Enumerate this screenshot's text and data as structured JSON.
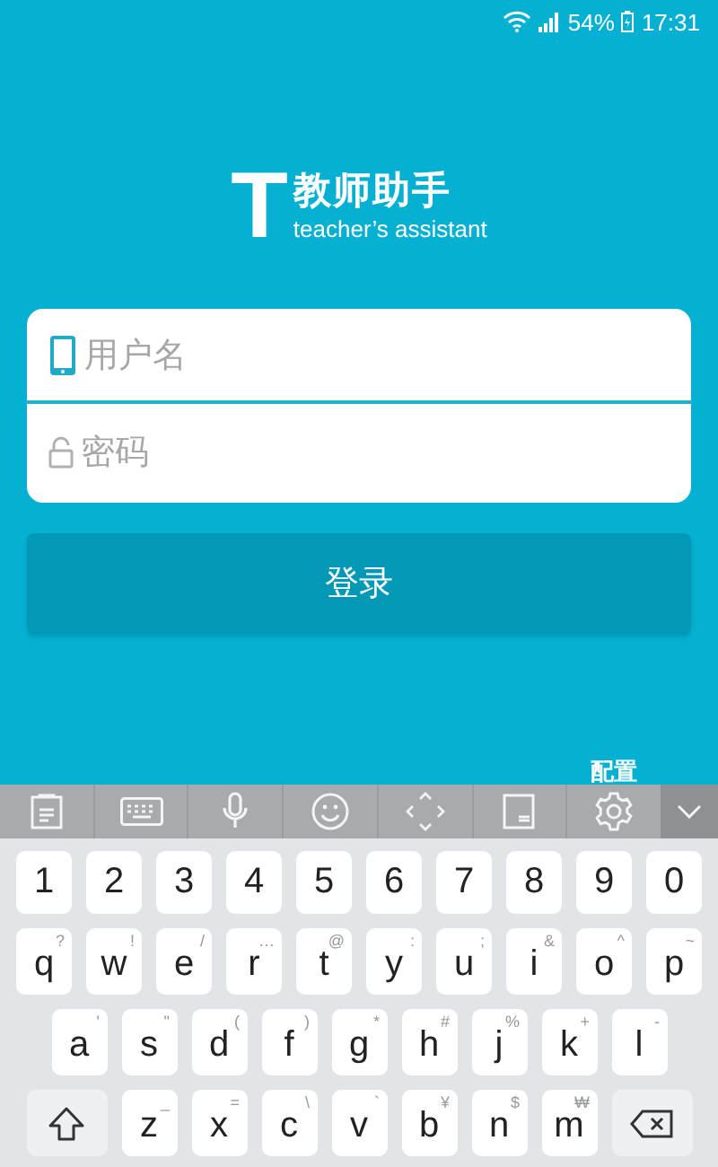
{
  "status_bar": {
    "battery": "54%",
    "time": "17:31"
  },
  "logo": {
    "letter": "T",
    "title": "教师助手",
    "subtitle": "teacher’s assistant"
  },
  "form": {
    "fields": [
      {
        "kind": "username",
        "placeholder": "用户名",
        "focused": true
      },
      {
        "kind": "password",
        "placeholder": "密码",
        "focused": false
      }
    ],
    "login_button": "登录",
    "config_link": "配置"
  },
  "keyboard": {
    "rows": [
      [
        {
          "label": "1"
        },
        {
          "label": "2"
        },
        {
          "label": "3"
        },
        {
          "label": "4"
        },
        {
          "label": "5"
        },
        {
          "label": "6"
        },
        {
          "label": "7"
        },
        {
          "label": "8"
        },
        {
          "label": "9"
        },
        {
          "label": "0"
        }
      ],
      [
        {
          "label": "q",
          "hint": "?"
        },
        {
          "label": "w",
          "hint": "!"
        },
        {
          "label": "e",
          "hint": "/"
        },
        {
          "label": "r",
          "hint": "…"
        },
        {
          "label": "t",
          "hint": "@"
        },
        {
          "label": "y",
          "hint": ":"
        },
        {
          "label": "u",
          "hint": ";"
        },
        {
          "label": "i",
          "hint": "&"
        },
        {
          "label": "o",
          "hint": "^"
        },
        {
          "label": "p",
          "hint": "~"
        }
      ],
      [
        {
          "label": "a",
          "hint": "'"
        },
        {
          "label": "s",
          "hint": "\""
        },
        {
          "label": "d",
          "hint": "("
        },
        {
          "label": "f",
          "hint": ")"
        },
        {
          "label": "g",
          "hint": "*"
        },
        {
          "label": "h",
          "hint": "#"
        },
        {
          "label": "j",
          "hint": "%"
        },
        {
          "label": "k",
          "hint": "+"
        },
        {
          "label": "l",
          "hint": "-"
        }
      ],
      [
        {
          "kind": "shift"
        },
        {
          "label": "z",
          "hint": "_"
        },
        {
          "label": "x",
          "hint": "="
        },
        {
          "label": "c",
          "hint": "\\"
        },
        {
          "label": "v",
          "hint": "`"
        },
        {
          "label": "b",
          "hint": "¥"
        },
        {
          "label": "n",
          "hint": "$"
        },
        {
          "label": "m",
          "hint": "₩"
        },
        {
          "kind": "backspace"
        }
      ]
    ]
  }
}
